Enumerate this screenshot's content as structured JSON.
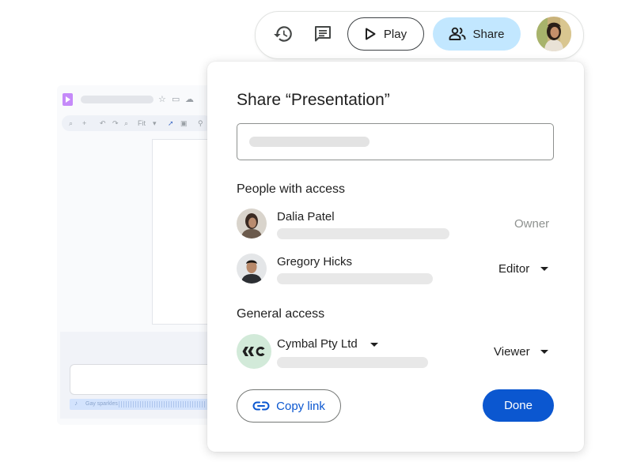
{
  "toolbar": {
    "play_label": "Play",
    "share_label": "Share",
    "icons": [
      "history-icon",
      "comments-icon",
      "play-icon",
      "people-icon"
    ]
  },
  "background_app": {
    "zoom_label": "Fit",
    "audio_caption": "Gay sparkles"
  },
  "dialog": {
    "title": "Share “Presentation”",
    "people_section": "People with access",
    "people": [
      {
        "name": "Dalia Patel",
        "role": "Owner"
      },
      {
        "name": "Gregory Hicks",
        "role": "Editor"
      }
    ],
    "general_section": "General access",
    "general": {
      "name": "Cymbal Pty Ltd",
      "role": "Viewer",
      "logo_text": "‹‹C"
    },
    "copy_link_label": "Copy link",
    "done_label": "Done"
  },
  "colors": {
    "accent": "#0b57d0",
    "share_bg": "#c2e7ff",
    "owner_text": "#8e918f",
    "logo_bg": "#d2ead9"
  }
}
